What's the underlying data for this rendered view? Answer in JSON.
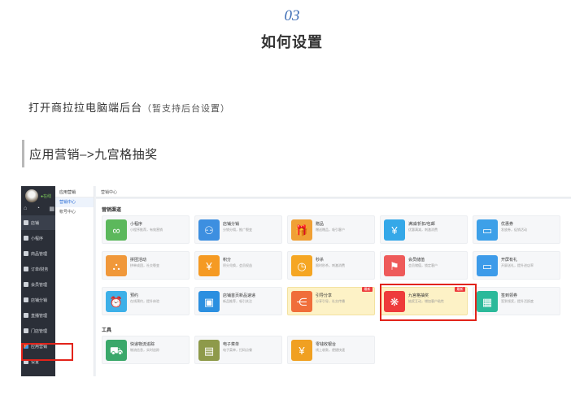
{
  "step": {
    "number": "03",
    "title": "如何设置"
  },
  "intro": {
    "text": "打开商拉拉电脑端后台",
    "note": "（暂支持后台设置）"
  },
  "section": {
    "text": "应用营销–>九宫格抽奖"
  },
  "app": {
    "sidebar": {
      "online": "●在线",
      "top_icons": [
        "⌂",
        "◔",
        "▦"
      ],
      "items": [
        {
          "label": "店铺"
        },
        {
          "label": "小程序"
        },
        {
          "label": "商品管理"
        },
        {
          "label": "订单/财务"
        },
        {
          "label": "会员管理"
        },
        {
          "label": "店铺分销"
        },
        {
          "label": "直播管理"
        },
        {
          "label": "门店管理"
        },
        {
          "label": "应用营销"
        },
        {
          "label": "设置"
        }
      ]
    },
    "subnav": {
      "header": "应用营销",
      "items": [
        {
          "label": "营销中心"
        },
        {
          "label": "帐号中心"
        }
      ]
    },
    "topbar": {
      "breadcrumb": "营销中心"
    },
    "groups": [
      {
        "title": "营销渠道",
        "cards": [
          {
            "name": "小程序",
            "desc": "小程序推荐，有效营销",
            "icon": "∞",
            "color": "#5cb85c"
          },
          {
            "name": "店铺分销",
            "desc": "分销分佣，推广裂变",
            "icon": "⚇",
            "color": "#3d8fe0"
          },
          {
            "name": "赠品",
            "desc": "赠送赠品，吸引客户",
            "icon": "🎁",
            "color": "#f0a035"
          },
          {
            "name": "满减/折扣/包邮",
            "desc": "优惠满减，刺激消费",
            "icon": "¥",
            "color": "#35a8e8"
          },
          {
            "name": "优惠券",
            "desc": "发放券，促销活动",
            "icon": "▭",
            "color": "#3da0e8"
          },
          {
            "name": "拼团活动",
            "desc": "拼单成团，社交裂变",
            "icon": "⛬",
            "color": "#f0983a"
          },
          {
            "name": "积分",
            "desc": "积分兑换，会员权益",
            "icon": "¥",
            "color": "#f59a23"
          },
          {
            "name": "秒杀",
            "desc": "限时秒杀，刺激消费",
            "icon": "◷",
            "color": "#f5a623"
          },
          {
            "name": "会员储值",
            "desc": "会员储值，锁定客户",
            "icon": "⚑",
            "color": "#ee5a5a"
          },
          {
            "name": "开屏有礼",
            "desc": "开屏送礼，提升进店率",
            "icon": "▭",
            "color": "#3d9be9"
          },
          {
            "name": "预约",
            "desc": "在线预约，提升体验",
            "icon": "⏰",
            "color": "#3db0e8"
          },
          {
            "name": "店铺首页新品速递",
            "desc": "新品推荐，吸引关注",
            "icon": "▣",
            "color": "#2b8fe0"
          },
          {
            "name": "引导分享",
            "desc": "分享引导，社交传播",
            "icon": "⋲",
            "color": "#f06e3a",
            "badge": "最新"
          },
          {
            "name": "九宫格抽奖",
            "desc": "抽奖互动，增加客户粘性",
            "icon": "❋",
            "color": "#ee3b3b",
            "badge": "最新"
          },
          {
            "name": "签到领券",
            "desc": "签到领奖，提升活跃度",
            "icon": "▦",
            "color": "#2bb99a"
          }
        ]
      },
      {
        "title": "工具",
        "cards": [
          {
            "name": "快递物流追踪",
            "desc": "物流信息，实时追踪",
            "icon": "⛟",
            "color": "#3aa86a"
          },
          {
            "name": "电子菜单",
            "desc": "电子菜单，扫码点餐",
            "icon": "▤",
            "color": "#8e9a4a"
          },
          {
            "name": "零钱收银台",
            "desc": "线上收款，便捷快速",
            "icon": "¥",
            "color": "#f0a022"
          }
        ]
      }
    ]
  }
}
